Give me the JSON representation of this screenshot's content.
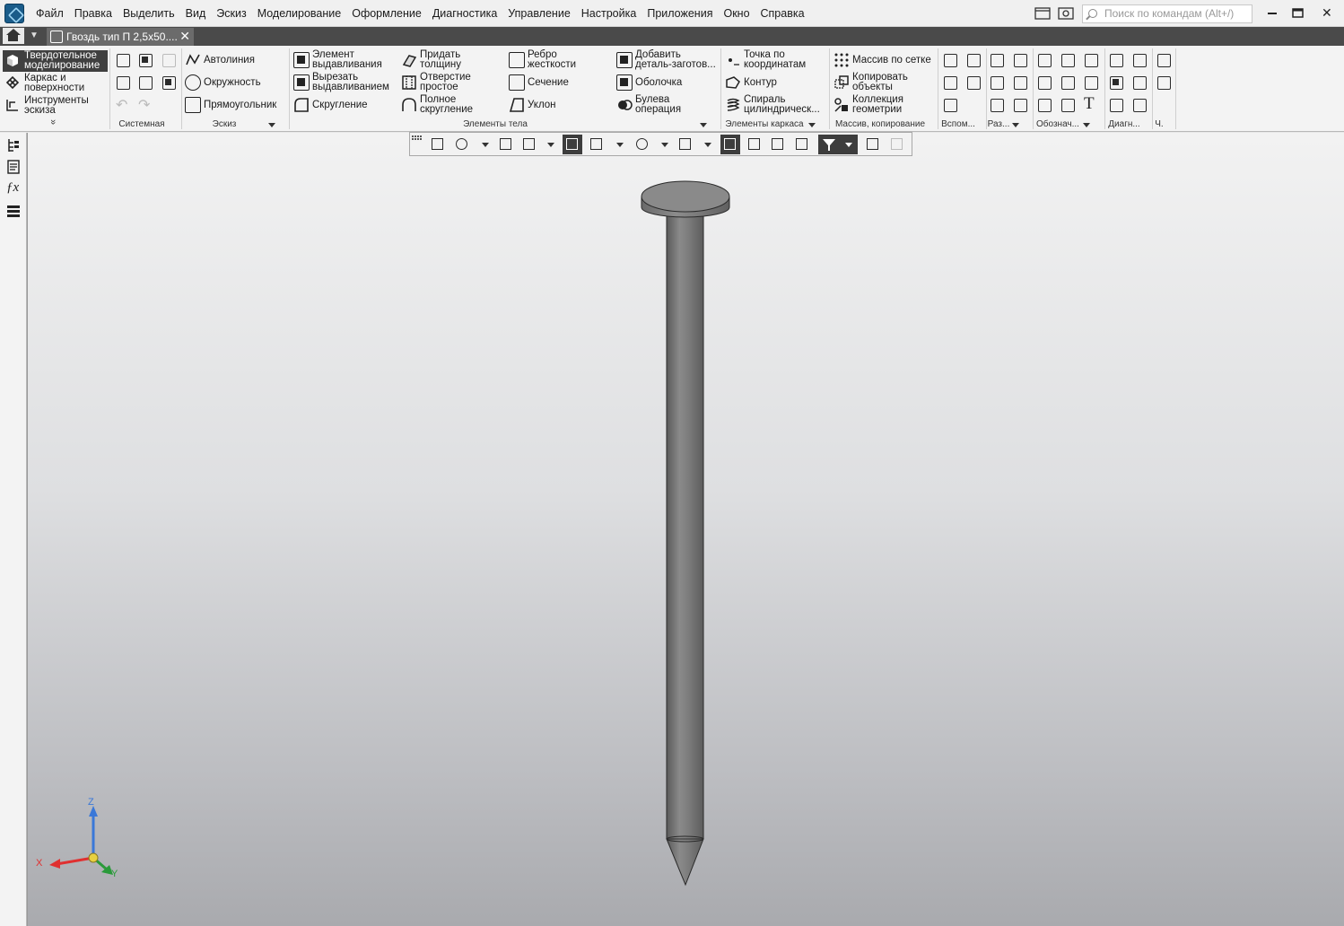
{
  "menubar": {
    "items": [
      "Файл",
      "Правка",
      "Выделить",
      "Вид",
      "Эскиз",
      "Моделирование",
      "Оформление",
      "Диагностика",
      "Управление",
      "Настройка",
      "Приложения",
      "Окно",
      "Справка"
    ],
    "search_placeholder": "Поиск по командам (Alt+/)",
    "window_controls": {
      "minimize": "minimize-icon",
      "maximize": "maximize-icon",
      "close": "✕"
    }
  },
  "tabbar": {
    "doc_tab_title": "Гвоздь тип П 2,5x50....",
    "close_symbol": "✕"
  },
  "ribbon": {
    "modes": [
      {
        "label": "Твердотельное\nмоделирование",
        "selected": true,
        "icon": "solid-cube-icon"
      },
      {
        "label": "Каркас и\nповерхности",
        "selected": false,
        "icon": "wireframe-icon"
      },
      {
        "label": "Инструменты\nэскиза",
        "selected": false,
        "icon": "sketch-tools-icon"
      }
    ],
    "sketch": [
      "Автолиния",
      "Окружность",
      "Прямоугольник"
    ],
    "body_col1": [
      "Элемент\nвыдавливания",
      "Вырезать\nвыдавливанием",
      "Скругление"
    ],
    "body_col2": [
      "Придать\nтолщину",
      "Отверстие\nпростое",
      "Полное\nскругление"
    ],
    "body_col3": [
      "Ребро\nжесткости",
      "Сечение",
      "Уклон"
    ],
    "body_col4": [
      "Добавить\nдеталь-заготов...",
      "Оболочка",
      "Булева\nоперация"
    ],
    "frame": [
      "Точка по\nкоординатам",
      "Контур",
      "Спираль\nцилиндрическ..."
    ],
    "array": [
      "Массив по сетке",
      "Копировать\nобъекты",
      "Коллекция\nгеометрии"
    ],
    "section_labels": {
      "system": "Системная",
      "sketch": "Эскиз",
      "body": "Элементы тела",
      "frame": "Элементы каркаса",
      "array": "Массив, копирование",
      "aux": "Вспом...",
      "size": "Раз...",
      "notation": "Обознач...",
      "diag": "Диагн...",
      "ch": "Ч."
    },
    "expand_symbol": "»"
  },
  "triad": {
    "x": "X",
    "y": "Y",
    "z": "Z"
  },
  "colors": {
    "menubar_bg": "#f0f0f0",
    "tabbar_bg": "#4a4a4a",
    "ribbon_bg": "#f3f3f3",
    "viewport_top": "#f2f2f2",
    "viewport_bottom": "#a9aaae",
    "nail": "#7a7a7a",
    "axis_x": "#e03030",
    "axis_y": "#2a9a3a",
    "axis_z": "#3a78d8"
  }
}
